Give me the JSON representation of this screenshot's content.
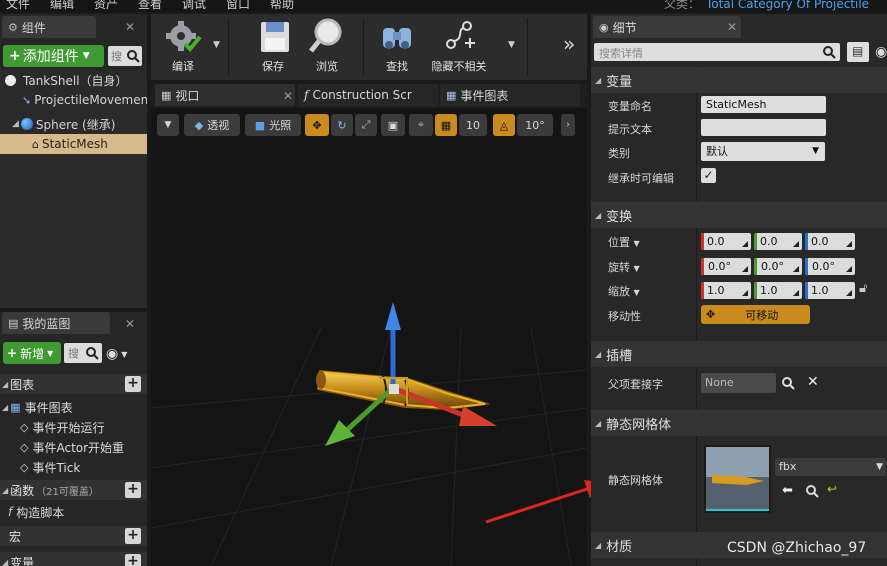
{
  "menu": {
    "items": [
      "文件",
      "编辑",
      "资产",
      "查看",
      "调试",
      "窗口",
      "帮助"
    ],
    "parent_label": "父类：",
    "parent_class": "Total Category Of Projectile"
  },
  "components_panel": {
    "tab_label": "组件",
    "add_component_label": "添加组件",
    "search_placeholder": "搜",
    "items": [
      {
        "label": "TankShell（自身）"
      },
      {
        "label": "ProjectileMovement"
      },
      {
        "label": "Sphere (继承)"
      },
      {
        "label": "StaticMesh"
      }
    ]
  },
  "my_blueprint": {
    "tab_label": "我的蓝图",
    "new_label": "新增",
    "search_placeholder": "搜",
    "graph_section": "图表",
    "event_graph": "事件图表",
    "events": [
      "事件开始运行",
      "事件Actor开始重",
      "事件Tick"
    ],
    "functions_section": "函数",
    "functions_count": "（21可覆盖）",
    "construction_script": "构造脚本",
    "macros_section": "宏",
    "variables_section": "变量"
  },
  "toolbar": {
    "compile_label": "编译",
    "save_label": "保存",
    "browse_label": "浏览",
    "find_label": "查找",
    "hide_unrelated_label": "隐藏不相关",
    "more": "»"
  },
  "editor_tabs": [
    {
      "label": "视口"
    },
    {
      "label": "Construction Scr"
    },
    {
      "label": "事件图表"
    }
  ],
  "viewport": {
    "perspective_label": "透视",
    "lit_label": "光照",
    "grid_snap_value": "10",
    "rotation_snap_value": "10°"
  },
  "details": {
    "tab_label": "细节",
    "search_placeholder": "搜索详情",
    "variable_section": "变量",
    "variable_name_label": "变量命名",
    "variable_name_value": "StaticMesh",
    "tooltip_label": "提示文本",
    "tooltip_value": "",
    "category_label": "类别",
    "category_value": "默认",
    "editable_when_inherited_label": "继承时可编辑",
    "editable_when_inherited_checked": true,
    "transform_section": "变换",
    "location_label": "位置",
    "location": [
      "0.0",
      "0.0",
      "0.0"
    ],
    "rotation_label": "旋转",
    "rotation": [
      "0.0°",
      "0.0°",
      "0.0°"
    ],
    "scale_label": "缩放",
    "scale": [
      "1.0",
      "1.0",
      "1.0"
    ],
    "mobility_label": "移动性",
    "mobility_value": "可移动",
    "sockets_section": "插槽",
    "parent_socket_label": "父项套接字",
    "parent_socket_value": "None",
    "static_mesh_section": "静态网格体",
    "static_mesh_label": "静态网格体",
    "static_mesh_asset": "fbx",
    "materials_section": "材质"
  },
  "watermark": "CSDN @Zhichao_97",
  "colors": {
    "accent_green": "#3f9a34",
    "selection": "#d8b98c",
    "mobility_orange": "#c98a1e",
    "axis_x": "#c8352a",
    "axis_y": "#4a9c2e",
    "axis_z": "#2a6fcf",
    "annotation_arrow": "#e0251b"
  }
}
